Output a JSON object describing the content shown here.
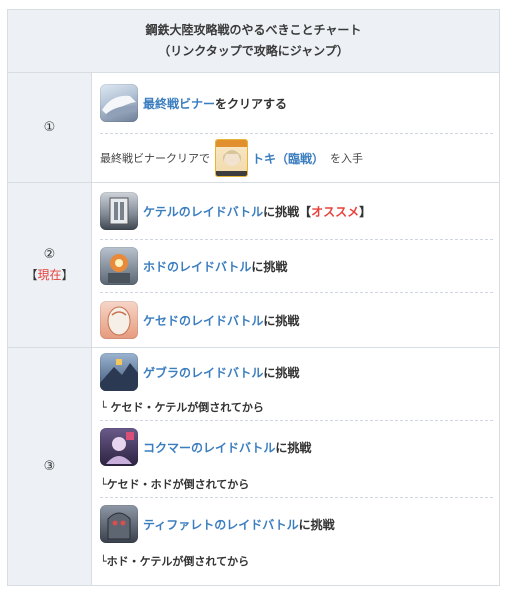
{
  "header": {
    "title_line1": "鋼鉄大陸攻略戦のやるべきことチャート",
    "title_line2": "（リンクタップで攻略にジャンプ）"
  },
  "steps": [
    {
      "num": "①",
      "items": [
        {
          "link": "最終戦ビナー",
          "suffix": "をクリアする",
          "icon": "binah-battle-icon"
        }
      ],
      "reward": {
        "prefix": "最終戦ビナークリアで",
        "link": "トキ（臨戦）",
        "suffix": "を入手",
        "icon": "toki-character-icon"
      }
    },
    {
      "num": "②",
      "badge_open": "【",
      "badge_text": "現在",
      "badge_close": "】",
      "items": [
        {
          "link": "ケテルのレイドバトル",
          "suffix": "に挑戦",
          "tag_open": "【",
          "tag": "オススメ",
          "tag_close": "】",
          "icon": "kether-raid-icon"
        },
        {
          "link": "ホドのレイドバトル",
          "suffix": "に挑戦",
          "icon": "hod-raid-icon"
        },
        {
          "link": "ケセドのレイドバトル",
          "suffix": "に挑戦",
          "icon": "chesed-raid-icon"
        }
      ]
    },
    {
      "num": "③",
      "items": [
        {
          "link": "ゲブラのレイドバトル",
          "suffix": "に挑戦",
          "note": "└ ケセド・ケテルが倒されてから",
          "icon": "gebura-raid-icon"
        },
        {
          "link": "コクマーのレイドバトル",
          "suffix": "に挑戦",
          "note": "└ケセド・ホドが倒されてから",
          "icon": "chokmah-raid-icon"
        },
        {
          "link": "ティファレトのレイドバトル",
          "suffix": "に挑戦",
          "note": "└ホド・ケテルが倒されてから",
          "icon": "tiphereth-raid-icon"
        }
      ]
    }
  ],
  "colors": {
    "link": "#3b7ec0",
    "accent_red": "#e8413a",
    "header_bg": "#edf1f5",
    "border": "#d8dde2"
  }
}
